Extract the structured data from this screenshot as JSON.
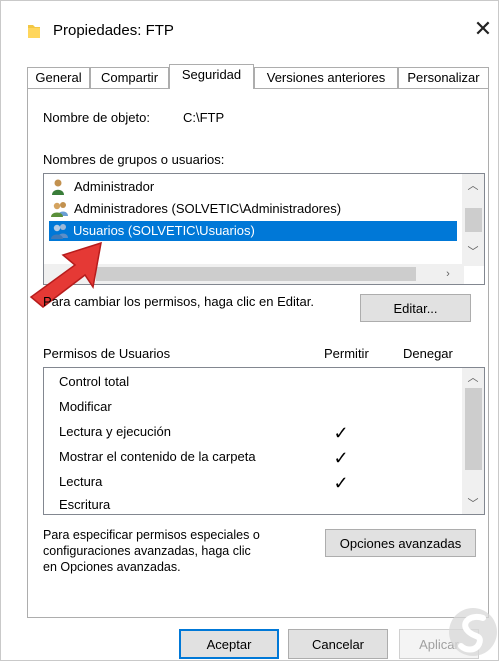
{
  "window": {
    "title": "Propiedades: FTP",
    "close_glyph": "✕"
  },
  "tabs": [
    {
      "label": "General"
    },
    {
      "label": "Compartir"
    },
    {
      "label": "Seguridad"
    },
    {
      "label": "Versiones anteriores"
    },
    {
      "label": "Personalizar"
    }
  ],
  "active_tab": "Seguridad",
  "object": {
    "label": "Nombre de objeto:",
    "value": "C:\\FTP"
  },
  "groups": {
    "label": "Nombres de grupos o usuarios:",
    "items": [
      {
        "label": "Administrador",
        "icon": "user-icon"
      },
      {
        "label": "Administradores (SOLVETIC\\Administradores)",
        "icon": "users-group-icon"
      },
      {
        "label": "Usuarios (SOLVETIC\\Usuarios)",
        "icon": "users-group-icon",
        "selected": true
      }
    ]
  },
  "edit": {
    "hint": "Para cambiar los permisos, haga clic en Editar.",
    "button_label": "Editar..."
  },
  "permissions": {
    "header": "Permisos de Usuarios",
    "allow_col": "Permitir",
    "deny_col": "Denegar",
    "rows": [
      {
        "label": "Control total",
        "allow": false
      },
      {
        "label": "Modificar",
        "allow": false
      },
      {
        "label": "Lectura y ejecución",
        "allow": true
      },
      {
        "label": "Mostrar el contenido de la carpeta",
        "allow": true
      },
      {
        "label": "Lectura",
        "allow": true
      },
      {
        "label": "Escritura",
        "allow": false
      }
    ],
    "check_glyph": "✓"
  },
  "advanced": {
    "hint_lines": [
      "Para especificar permisos especiales o",
      "configuraciones avanzadas, haga clic",
      "en Opciones avanzadas."
    ],
    "button_label": "Opciones avanzadas"
  },
  "footer": {
    "accept": "Aceptar",
    "cancel": "Cancelar",
    "apply": "Aplicar"
  },
  "colors": {
    "accent": "#0078d7",
    "arrow": "#e53935",
    "folder": "#f2c744"
  }
}
